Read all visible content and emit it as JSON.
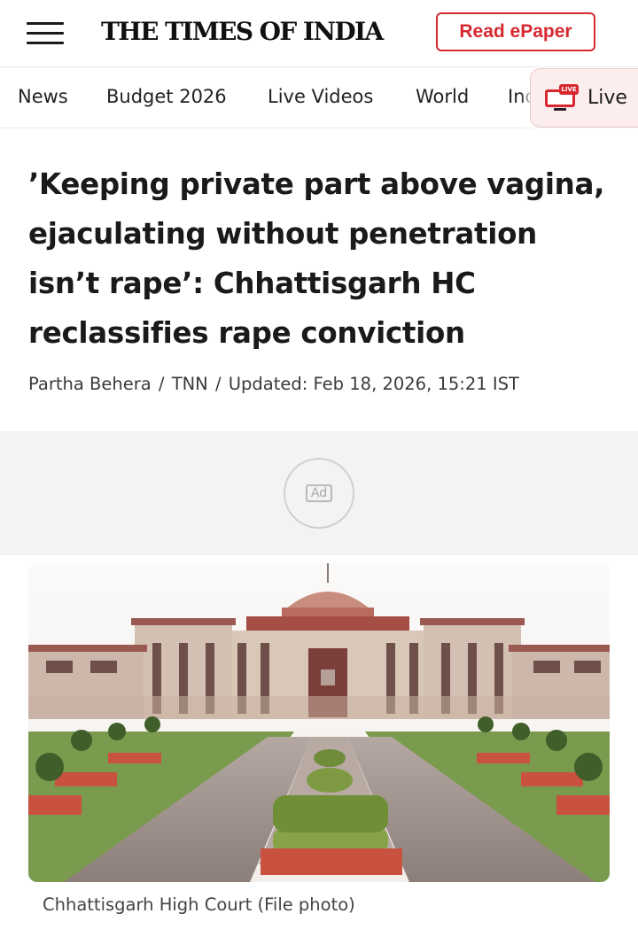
{
  "header": {
    "logo_text": "THE TIMES OF INDIA",
    "epaper_label": "Read ePaper",
    "menu_icon": "hamburger-menu-icon"
  },
  "nav": {
    "items": [
      "News",
      "Budget 2026",
      "Live Videos",
      "World",
      "Ind"
    ],
    "live_label": "Live",
    "live_badge": "LIVE",
    "live_icon": "live-tv-icon"
  },
  "article": {
    "headline": "’Keeping private part above vagina, ejaculating without penetration isn’t rape’: Chhattisgarh HC reclassifies rape conviction",
    "author": "Partha Behera",
    "source": "TNN",
    "updated": "Updated: Feb 18, 2026, 15:21 IST"
  },
  "ad": {
    "label": "Ad"
  },
  "image": {
    "caption": "Chhattisgarh High Court (File photo)"
  },
  "colors": {
    "brand_red": "#d7282f",
    "live_bg": "#fdeeee",
    "ad_bg": "#f3f3f3"
  }
}
